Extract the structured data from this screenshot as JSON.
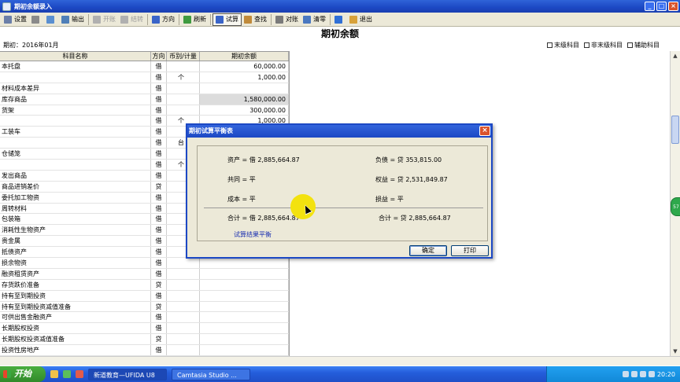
{
  "window": {
    "title": "期初余额录入"
  },
  "toolbar": [
    {
      "key": "settings",
      "label": "设置",
      "state": "normal",
      "color": "#6b7fa8"
    },
    {
      "key": "print",
      "label": "",
      "state": "normal",
      "color": "#8a8a8a"
    },
    {
      "key": "preview",
      "label": "",
      "state": "normal",
      "color": "#5a8fd0"
    },
    {
      "key": "output",
      "label": "输出",
      "state": "normal",
      "color": "#4f7fb8"
    },
    {
      "key": "open",
      "label": "开账",
      "state": "disabled",
      "color": "#b0b0b0"
    },
    {
      "key": "close",
      "label": "结转",
      "state": "disabled",
      "color": "#b0b0b0"
    },
    {
      "key": "direction",
      "label": "方向",
      "state": "normal",
      "color": "#3a64c8"
    },
    {
      "key": "refresh",
      "label": "刷新",
      "state": "normal",
      "color": "#3f9a3f"
    },
    {
      "key": "trial",
      "label": "试算",
      "state": "active",
      "color": "#3a64c8"
    },
    {
      "key": "find",
      "label": "查找",
      "state": "normal",
      "color": "#c08a3a"
    },
    {
      "key": "reconcile",
      "label": "对账",
      "state": "normal",
      "color": "#7a7a7a"
    },
    {
      "key": "clear",
      "label": "清零",
      "state": "normal",
      "color": "#4a78c0"
    },
    {
      "key": "help",
      "label": "",
      "state": "normal",
      "color": "#2f6fd6"
    },
    {
      "key": "exit",
      "label": "退出",
      "state": "normal",
      "color": "#d8a23a"
    }
  ],
  "page": {
    "heading": "期初余额",
    "period": "期初：2016年01月"
  },
  "filters": [
    "末级科目",
    "非末级科目",
    "辅助科目"
  ],
  "grid": {
    "headers": [
      "科目名称",
      "方向",
      "币别/计量",
      "期初余额"
    ],
    "rows": [
      {
        "name": "   本托盘",
        "dir": "借",
        "unit": "",
        "amount": "60,000.00",
        "shade": false
      },
      {
        "name": "",
        "dir": "借",
        "unit": "个",
        "amount": "1,000.00",
        "shade": false
      },
      {
        "name": "材料成本差异",
        "dir": "借",
        "unit": "",
        "amount": "",
        "shade": false
      },
      {
        "name": "库存商品",
        "dir": "借",
        "unit": "",
        "amount": "1,580,000.00",
        "shade": true
      },
      {
        "name": "   货架",
        "dir": "借",
        "unit": "",
        "amount": "300,000.00",
        "shade": false
      },
      {
        "name": "",
        "dir": "借",
        "unit": "个",
        "amount": "1,000.00",
        "shade": false
      },
      {
        "name": "   工装车",
        "dir": "借",
        "unit": "",
        "amount": "",
        "shade": false
      },
      {
        "name": "",
        "dir": "借",
        "unit": "台",
        "amount": "",
        "shade": false
      },
      {
        "name": "   仓储笼",
        "dir": "借",
        "unit": "",
        "amount": "",
        "shade": false
      },
      {
        "name": "",
        "dir": "借",
        "unit": "个",
        "amount": "",
        "shade": false
      },
      {
        "name": "发出商品",
        "dir": "借",
        "unit": "",
        "amount": "",
        "shade": false
      },
      {
        "name": "商品进销差价",
        "dir": "贷",
        "unit": "",
        "amount": "",
        "shade": false
      },
      {
        "name": "委托加工物资",
        "dir": "借",
        "unit": "",
        "amount": "",
        "shade": false
      },
      {
        "name": "周转材料",
        "dir": "借",
        "unit": "",
        "amount": "",
        "shade": false
      },
      {
        "name": "   包装箱",
        "dir": "借",
        "unit": "",
        "amount": "",
        "shade": false
      },
      {
        "name": "消耗性生物资产",
        "dir": "借",
        "unit": "",
        "amount": "",
        "shade": false
      },
      {
        "name": "贵金属",
        "dir": "借",
        "unit": "",
        "amount": "",
        "shade": false
      },
      {
        "name": "抵债资产",
        "dir": "借",
        "unit": "",
        "amount": "",
        "shade": false
      },
      {
        "name": "损余物资",
        "dir": "借",
        "unit": "",
        "amount": "",
        "shade": false
      },
      {
        "name": "融资租赁资产",
        "dir": "借",
        "unit": "",
        "amount": "",
        "shade": false
      },
      {
        "name": "存货跌价准备",
        "dir": "贷",
        "unit": "",
        "amount": "",
        "shade": false
      },
      {
        "name": "持有至到期投资",
        "dir": "借",
        "unit": "",
        "amount": "",
        "shade": false
      },
      {
        "name": "持有至到期投资减值准备",
        "dir": "贷",
        "unit": "",
        "amount": "",
        "shade": false
      },
      {
        "name": "可供出售金融资产",
        "dir": "借",
        "unit": "",
        "amount": "",
        "shade": false
      },
      {
        "name": "长期股权投资",
        "dir": "借",
        "unit": "",
        "amount": "",
        "shade": false
      },
      {
        "name": "长期股权投资减值准备",
        "dir": "贷",
        "unit": "",
        "amount": "",
        "shade": false
      },
      {
        "name": "投资性房地产",
        "dir": "借",
        "unit": "",
        "amount": "",
        "shade": false
      }
    ]
  },
  "dialog": {
    "title": "期初试算平衡表",
    "assets": "资产 =  借 2,885,664.87",
    "liabilities": "负债 =   贷 353,815.00",
    "common": "共同 =  平",
    "equity": "权益 =   贷 2,531,849.87",
    "cost": "成本 =  平",
    "pnl": "损益 =   平",
    "total_left": "合计 = 借 2,885,664.87",
    "total_right": "合计 =   贷 2,885,664.87",
    "result": "试算结果平衡",
    "ok_label": "确定",
    "print_label": "打印"
  },
  "side_badge": "57",
  "taskbar": {
    "start": "开始",
    "tasks": [
      {
        "label": "新道教育—UFIDA U8",
        "active": true
      },
      {
        "label": "Camtasia Studio ...",
        "active": false
      }
    ],
    "clock": "20:20"
  }
}
